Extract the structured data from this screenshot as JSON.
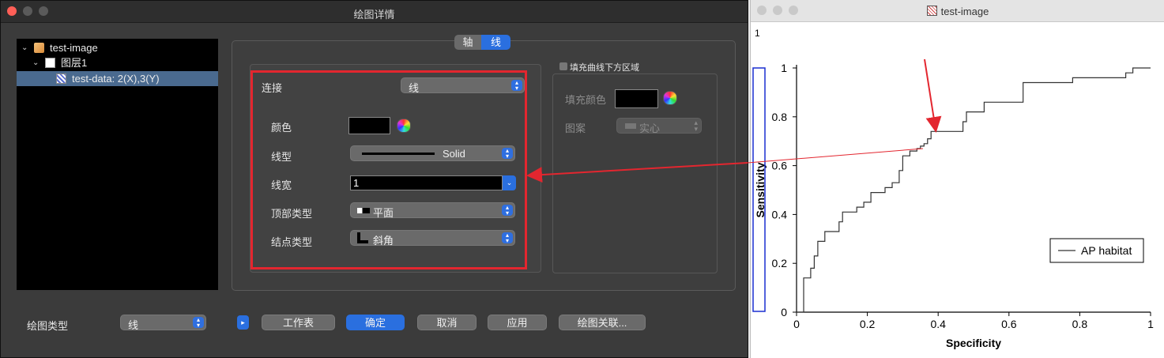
{
  "dialog": {
    "title": "绘图详情",
    "tree": {
      "root": "test-image",
      "layer": "图层1",
      "data": "test-data: 2(X),3(Y)"
    },
    "tabs": {
      "axis": "轴",
      "line": "线"
    },
    "line_tab": {
      "connect_label": "连接",
      "connect_value": "线",
      "color_label": "颜色",
      "linetype_label": "线型",
      "linetype_value": "Solid",
      "linewidth_label": "线宽",
      "linewidth_value": "1",
      "cap_label": "顶部类型",
      "cap_value": "平面",
      "join_label": "结点类型",
      "join_value": "斜角"
    },
    "fill": {
      "checkbox_label": "填充曲线下方区域",
      "fill_color_label": "填充颜色",
      "pattern_label": "图案",
      "pattern_value": "实心"
    },
    "bottom": {
      "plot_type_label": "绘图类型",
      "plot_type_value": "线",
      "worksheet": "工作表",
      "ok": "确定",
      "cancel": "取消",
      "apply": "应用",
      "associate": "绘图关联..."
    }
  },
  "plot_window": {
    "title": "test-image",
    "layer_number": "1"
  },
  "chart_data": {
    "type": "line",
    "xlabel": "Specificity",
    "ylabel": "Sensitivity",
    "xlim": [
      0,
      1
    ],
    "ylim": [
      0,
      1
    ],
    "xticks": [
      "0",
      "0.2",
      "0.4",
      "0.6",
      "0.8",
      "1"
    ],
    "yticks": [
      "0",
      "0.2",
      "0.4",
      "0.6",
      "0.8",
      "1"
    ],
    "legend_position": "lower-right",
    "series": [
      {
        "name": "AP habitat",
        "color": "#333333",
        "x": [
          0,
          0.02,
          0.02,
          0.04,
          0.04,
          0.05,
          0.05,
          0.06,
          0.06,
          0.08,
          0.08,
          0.12,
          0.12,
          0.13,
          0.13,
          0.17,
          0.17,
          0.19,
          0.19,
          0.21,
          0.21,
          0.25,
          0.25,
          0.27,
          0.27,
          0.29,
          0.29,
          0.3,
          0.3,
          0.32,
          0.32,
          0.34,
          0.34,
          0.35,
          0.35,
          0.36,
          0.36,
          0.37,
          0.37,
          0.38,
          0.38,
          0.47,
          0.47,
          0.48,
          0.48,
          0.53,
          0.53,
          0.56,
          0.56,
          0.64,
          0.64,
          0.78,
          0.78,
          0.93,
          0.93,
          0.95,
          0.95,
          1.0
        ],
        "y": [
          0,
          0,
          0.14,
          0.14,
          0.18,
          0.18,
          0.23,
          0.23,
          0.29,
          0.29,
          0.33,
          0.33,
          0.37,
          0.37,
          0.41,
          0.41,
          0.43,
          0.43,
          0.45,
          0.45,
          0.49,
          0.49,
          0.51,
          0.51,
          0.53,
          0.53,
          0.58,
          0.58,
          0.64,
          0.64,
          0.66,
          0.66,
          0.67,
          0.67,
          0.68,
          0.68,
          0.69,
          0.69,
          0.71,
          0.71,
          0.74,
          0.74,
          0.78,
          0.78,
          0.82,
          0.82,
          0.86,
          0.86,
          0.86,
          0.86,
          0.94,
          0.94,
          0.96,
          0.96,
          0.98,
          0.98,
          1.0,
          1.0
        ]
      }
    ]
  },
  "annotation_colors": {
    "highlight": "#e3262f"
  }
}
